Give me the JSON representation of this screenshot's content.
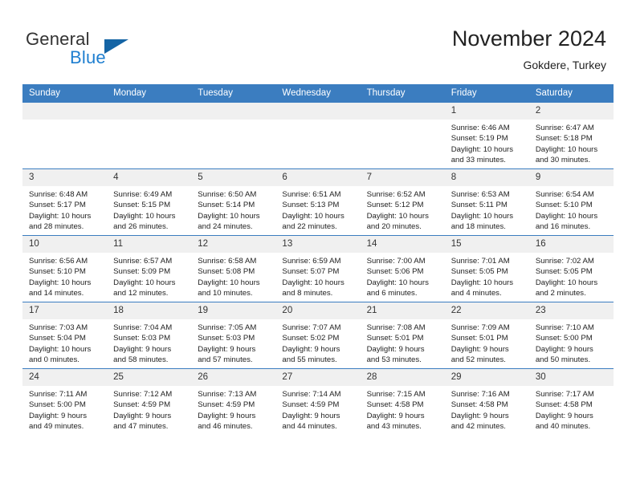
{
  "brand": {
    "name_part1": "General",
    "name_part2": "Blue",
    "triangle_icon": "triangle-logo-icon",
    "accent_color": "#1f7fd0",
    "logo_triangle_color": "#1464a5"
  },
  "header": {
    "title": "November 2024",
    "subtitle": "Gokdere, Turkey"
  },
  "theme": {
    "header_row_bg": "#3b7dc0",
    "daynum_bg": "#f0f0f0",
    "grid_line": "#3b7dc0"
  },
  "calendar": {
    "weekday_headers": [
      "Sunday",
      "Monday",
      "Tuesday",
      "Wednesday",
      "Thursday",
      "Friday",
      "Saturday"
    ],
    "weeks": [
      [
        {
          "day": "",
          "empty": true,
          "sunrise": "",
          "sunset": "",
          "daylight_line1": "",
          "daylight_line2": ""
        },
        {
          "day": "",
          "empty": true,
          "sunrise": "",
          "sunset": "",
          "daylight_line1": "",
          "daylight_line2": ""
        },
        {
          "day": "",
          "empty": true,
          "sunrise": "",
          "sunset": "",
          "daylight_line1": "",
          "daylight_line2": ""
        },
        {
          "day": "",
          "empty": true,
          "sunrise": "",
          "sunset": "",
          "daylight_line1": "",
          "daylight_line2": ""
        },
        {
          "day": "",
          "empty": true,
          "sunrise": "",
          "sunset": "",
          "daylight_line1": "",
          "daylight_line2": ""
        },
        {
          "day": "1",
          "empty": false,
          "sunrise": "Sunrise: 6:46 AM",
          "sunset": "Sunset: 5:19 PM",
          "daylight_line1": "Daylight: 10 hours",
          "daylight_line2": "and 33 minutes."
        },
        {
          "day": "2",
          "empty": false,
          "sunrise": "Sunrise: 6:47 AM",
          "sunset": "Sunset: 5:18 PM",
          "daylight_line1": "Daylight: 10 hours",
          "daylight_line2": "and 30 minutes."
        }
      ],
      [
        {
          "day": "3",
          "empty": false,
          "sunrise": "Sunrise: 6:48 AM",
          "sunset": "Sunset: 5:17 PM",
          "daylight_line1": "Daylight: 10 hours",
          "daylight_line2": "and 28 minutes."
        },
        {
          "day": "4",
          "empty": false,
          "sunrise": "Sunrise: 6:49 AM",
          "sunset": "Sunset: 5:15 PM",
          "daylight_line1": "Daylight: 10 hours",
          "daylight_line2": "and 26 minutes."
        },
        {
          "day": "5",
          "empty": false,
          "sunrise": "Sunrise: 6:50 AM",
          "sunset": "Sunset: 5:14 PM",
          "daylight_line1": "Daylight: 10 hours",
          "daylight_line2": "and 24 minutes."
        },
        {
          "day": "6",
          "empty": false,
          "sunrise": "Sunrise: 6:51 AM",
          "sunset": "Sunset: 5:13 PM",
          "daylight_line1": "Daylight: 10 hours",
          "daylight_line2": "and 22 minutes."
        },
        {
          "day": "7",
          "empty": false,
          "sunrise": "Sunrise: 6:52 AM",
          "sunset": "Sunset: 5:12 PM",
          "daylight_line1": "Daylight: 10 hours",
          "daylight_line2": "and 20 minutes."
        },
        {
          "day": "8",
          "empty": false,
          "sunrise": "Sunrise: 6:53 AM",
          "sunset": "Sunset: 5:11 PM",
          "daylight_line1": "Daylight: 10 hours",
          "daylight_line2": "and 18 minutes."
        },
        {
          "day": "9",
          "empty": false,
          "sunrise": "Sunrise: 6:54 AM",
          "sunset": "Sunset: 5:10 PM",
          "daylight_line1": "Daylight: 10 hours",
          "daylight_line2": "and 16 minutes."
        }
      ],
      [
        {
          "day": "10",
          "empty": false,
          "sunrise": "Sunrise: 6:56 AM",
          "sunset": "Sunset: 5:10 PM",
          "daylight_line1": "Daylight: 10 hours",
          "daylight_line2": "and 14 minutes."
        },
        {
          "day": "11",
          "empty": false,
          "sunrise": "Sunrise: 6:57 AM",
          "sunset": "Sunset: 5:09 PM",
          "daylight_line1": "Daylight: 10 hours",
          "daylight_line2": "and 12 minutes."
        },
        {
          "day": "12",
          "empty": false,
          "sunrise": "Sunrise: 6:58 AM",
          "sunset": "Sunset: 5:08 PM",
          "daylight_line1": "Daylight: 10 hours",
          "daylight_line2": "and 10 minutes."
        },
        {
          "day": "13",
          "empty": false,
          "sunrise": "Sunrise: 6:59 AM",
          "sunset": "Sunset: 5:07 PM",
          "daylight_line1": "Daylight: 10 hours",
          "daylight_line2": "and 8 minutes."
        },
        {
          "day": "14",
          "empty": false,
          "sunrise": "Sunrise: 7:00 AM",
          "sunset": "Sunset: 5:06 PM",
          "daylight_line1": "Daylight: 10 hours",
          "daylight_line2": "and 6 minutes."
        },
        {
          "day": "15",
          "empty": false,
          "sunrise": "Sunrise: 7:01 AM",
          "sunset": "Sunset: 5:05 PM",
          "daylight_line1": "Daylight: 10 hours",
          "daylight_line2": "and 4 minutes."
        },
        {
          "day": "16",
          "empty": false,
          "sunrise": "Sunrise: 7:02 AM",
          "sunset": "Sunset: 5:05 PM",
          "daylight_line1": "Daylight: 10 hours",
          "daylight_line2": "and 2 minutes."
        }
      ],
      [
        {
          "day": "17",
          "empty": false,
          "sunrise": "Sunrise: 7:03 AM",
          "sunset": "Sunset: 5:04 PM",
          "daylight_line1": "Daylight: 10 hours",
          "daylight_line2": "and 0 minutes."
        },
        {
          "day": "18",
          "empty": false,
          "sunrise": "Sunrise: 7:04 AM",
          "sunset": "Sunset: 5:03 PM",
          "daylight_line1": "Daylight: 9 hours",
          "daylight_line2": "and 58 minutes."
        },
        {
          "day": "19",
          "empty": false,
          "sunrise": "Sunrise: 7:05 AM",
          "sunset": "Sunset: 5:03 PM",
          "daylight_line1": "Daylight: 9 hours",
          "daylight_line2": "and 57 minutes."
        },
        {
          "day": "20",
          "empty": false,
          "sunrise": "Sunrise: 7:07 AM",
          "sunset": "Sunset: 5:02 PM",
          "daylight_line1": "Daylight: 9 hours",
          "daylight_line2": "and 55 minutes."
        },
        {
          "day": "21",
          "empty": false,
          "sunrise": "Sunrise: 7:08 AM",
          "sunset": "Sunset: 5:01 PM",
          "daylight_line1": "Daylight: 9 hours",
          "daylight_line2": "and 53 minutes."
        },
        {
          "day": "22",
          "empty": false,
          "sunrise": "Sunrise: 7:09 AM",
          "sunset": "Sunset: 5:01 PM",
          "daylight_line1": "Daylight: 9 hours",
          "daylight_line2": "and 52 minutes."
        },
        {
          "day": "23",
          "empty": false,
          "sunrise": "Sunrise: 7:10 AM",
          "sunset": "Sunset: 5:00 PM",
          "daylight_line1": "Daylight: 9 hours",
          "daylight_line2": "and 50 minutes."
        }
      ],
      [
        {
          "day": "24",
          "empty": false,
          "sunrise": "Sunrise: 7:11 AM",
          "sunset": "Sunset: 5:00 PM",
          "daylight_line1": "Daylight: 9 hours",
          "daylight_line2": "and 49 minutes."
        },
        {
          "day": "25",
          "empty": false,
          "sunrise": "Sunrise: 7:12 AM",
          "sunset": "Sunset: 4:59 PM",
          "daylight_line1": "Daylight: 9 hours",
          "daylight_line2": "and 47 minutes."
        },
        {
          "day": "26",
          "empty": false,
          "sunrise": "Sunrise: 7:13 AM",
          "sunset": "Sunset: 4:59 PM",
          "daylight_line1": "Daylight: 9 hours",
          "daylight_line2": "and 46 minutes."
        },
        {
          "day": "27",
          "empty": false,
          "sunrise": "Sunrise: 7:14 AM",
          "sunset": "Sunset: 4:59 PM",
          "daylight_line1": "Daylight: 9 hours",
          "daylight_line2": "and 44 minutes."
        },
        {
          "day": "28",
          "empty": false,
          "sunrise": "Sunrise: 7:15 AM",
          "sunset": "Sunset: 4:58 PM",
          "daylight_line1": "Daylight: 9 hours",
          "daylight_line2": "and 43 minutes."
        },
        {
          "day": "29",
          "empty": false,
          "sunrise": "Sunrise: 7:16 AM",
          "sunset": "Sunset: 4:58 PM",
          "daylight_line1": "Daylight: 9 hours",
          "daylight_line2": "and 42 minutes."
        },
        {
          "day": "30",
          "empty": false,
          "sunrise": "Sunrise: 7:17 AM",
          "sunset": "Sunset: 4:58 PM",
          "daylight_line1": "Daylight: 9 hours",
          "daylight_line2": "and 40 minutes."
        }
      ]
    ]
  }
}
